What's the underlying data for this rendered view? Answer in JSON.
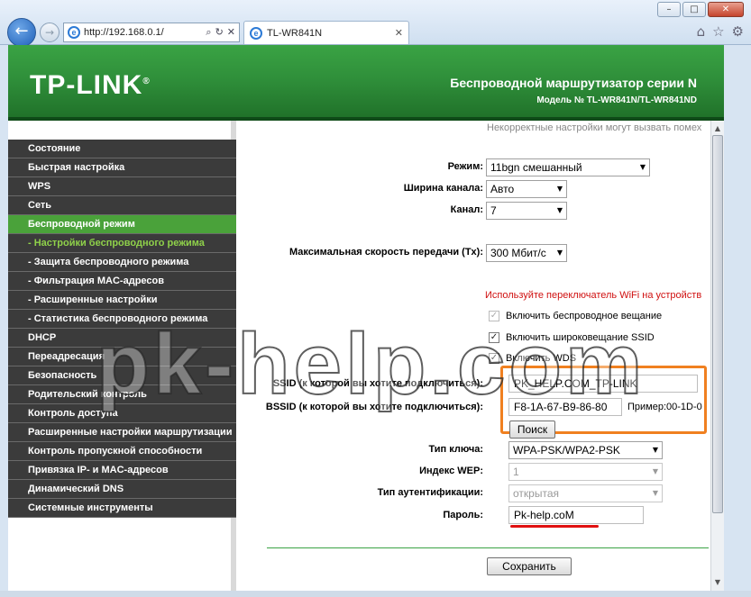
{
  "browser": {
    "address": "http://192.168.0.1/",
    "tab_title": "TL-WR841N",
    "window_controls": [
      "minimize",
      "maximize",
      "close"
    ],
    "icons": [
      "back-arrow-icon",
      "forward-arrow-icon",
      "ie-logo-icon",
      "search-icon",
      "refresh-icon",
      "stop-icon",
      "home-icon",
      "star-icon",
      "gear-icon"
    ]
  },
  "header": {
    "logo": "TP-LINK",
    "title": "Беспроводной маршрутизатор серии N",
    "model": "Модель № TL-WR841N/TL-WR841ND"
  },
  "sidebar": {
    "items": [
      {
        "label": "Состояние",
        "kind": "main"
      },
      {
        "label": "Быстрая настройка",
        "kind": "main"
      },
      {
        "label": "WPS",
        "kind": "main"
      },
      {
        "label": "Сеть",
        "kind": "main"
      },
      {
        "label": "Беспроводной режим",
        "kind": "active"
      },
      {
        "label": "- Настройки беспроводного режима",
        "kind": "sub-active"
      },
      {
        "label": "- Защита беспроводного режима",
        "kind": "sub"
      },
      {
        "label": "- Фильтрация MAC-адресов",
        "kind": "sub"
      },
      {
        "label": "- Расширенные настройки",
        "kind": "sub"
      },
      {
        "label": "- Статистика беспроводного режима",
        "kind": "sub"
      },
      {
        "label": "DHCP",
        "kind": "main"
      },
      {
        "label": "Переадресация",
        "kind": "main"
      },
      {
        "label": "Безопасность",
        "kind": "main"
      },
      {
        "label": "Родительский контроль",
        "kind": "main"
      },
      {
        "label": "Контроль доступа",
        "kind": "main"
      },
      {
        "label": "Расширенные настройки маршрутизации",
        "kind": "main"
      },
      {
        "label": "Контроль пропускной способности",
        "kind": "main"
      },
      {
        "label": "Привязка IP- и MAC-адресов",
        "kind": "main"
      },
      {
        "label": "Динамический DNS",
        "kind": "main"
      },
      {
        "label": "Системные инструменты",
        "kind": "main"
      }
    ]
  },
  "content": {
    "note_top": "Некорректные настройки могут вызвать помех",
    "mode_label": "Режим:",
    "mode_value": "11bgn смешанный",
    "width_label": "Ширина канала:",
    "width_value": "Авто",
    "channel_label": "Канал:",
    "channel_value": "7",
    "rate_label": "Максимальная скорость передачи (Tx):",
    "rate_value": "300 Мбит/с",
    "warning": "Используйте переключатель WiFi на устройств",
    "cb_radio": "Включить беспроводное вещание",
    "cb_ssid_broadcast": "Включить широковещание SSID",
    "cb_wds": "Включить WDS",
    "ssid_label": "SSID (к которой вы хотите подключиться):",
    "ssid_value": "PK_HELP.COM_TP-LINK",
    "bssid_label": "BSSID (к которой вы хотите подключиться):",
    "bssid_value": "F8-1A-67-B9-86-80",
    "bssid_hint": "Пример:00-1D-0",
    "search_button": "Поиск",
    "key_type_label": "Тип ключа:",
    "key_type_value": "WPA-PSK/WPA2-PSK",
    "wep_index_label": "Индекс WEP:",
    "wep_index_value": "1",
    "auth_type_label": "Тип аутентификации:",
    "auth_type_value": "открытая",
    "password_label": "Пароль:",
    "password_value": "Pk-help.coM",
    "save_button": "Сохранить"
  },
  "watermark": "pk-help.com",
  "colors": {
    "header_green": "#2f8f3a",
    "menu_dark": "#3b3b3b",
    "menu_active": "#4aa23a",
    "highlight_frame": "#f08020",
    "underline_red": "#e01010"
  }
}
